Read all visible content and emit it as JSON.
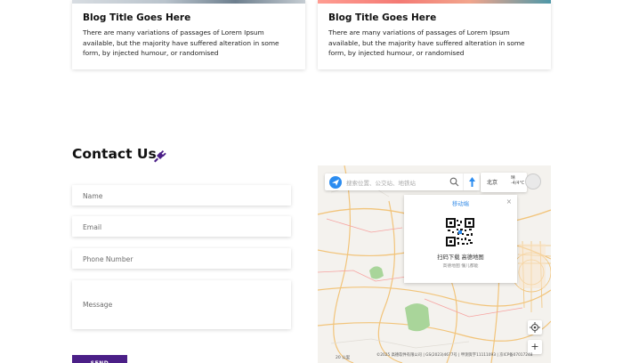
{
  "blog_cards": [
    {
      "title": "Blog Title Goes Here",
      "excerpt": "There are many variations of passages of Lorem Ipsum available, but the majority have suffered alteration in some form, by injected humour, or randomised"
    },
    {
      "title": "Blog Title Goes Here",
      "excerpt": "There are many variations of passages of Lorem Ipsum available, but the majority have suffered alteration in some form, by injected humour, or randomised"
    }
  ],
  "contact": {
    "title": "Contact Us",
    "icon": "plug-icon",
    "accent": "#4b1f87",
    "fields": {
      "name_placeholder": "Name",
      "email_placeholder": "Email",
      "phone_placeholder": "Phone Number",
      "message_placeholder": "Message"
    },
    "send_label": "SEND"
  },
  "map": {
    "search_placeholder": "搜索位置、公交站、地铁站",
    "weather_city": "北京",
    "weather_temp": "晴 -4/4°C",
    "qr_tab": "移动端",
    "qr_label": "扫码下载 高德地图",
    "qr_sub": "高德地图 懂儿都能",
    "zoom_in": "+",
    "scale": "20 公里",
    "copyright": "©2025 高德软件有限公司 | GS(2023)4677号 | 甲测资字11111093 | 京ICP备07017248"
  }
}
